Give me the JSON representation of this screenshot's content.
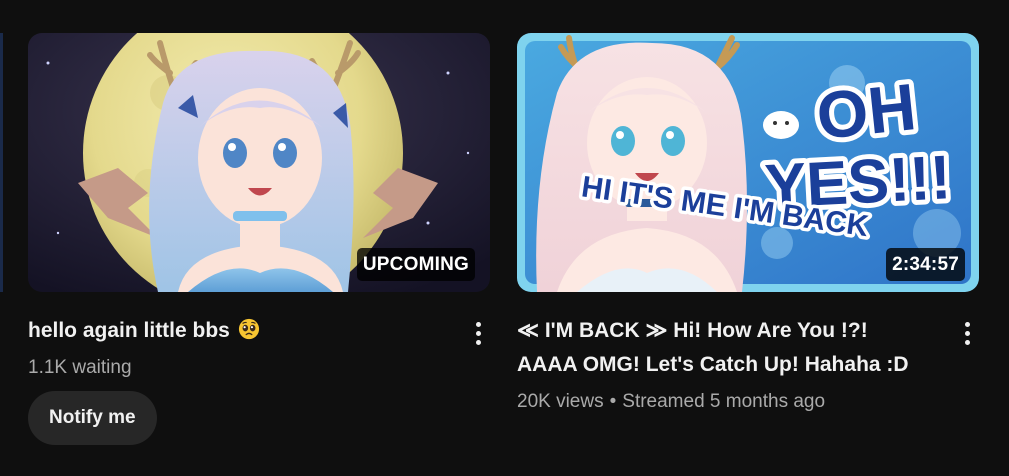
{
  "videos": [
    {
      "title": "hello again little bbs",
      "emoji": "pleading-face",
      "badge": "UPCOMING",
      "stats": "1.1K waiting",
      "action_label": "Notify me"
    },
    {
      "title_line1": "≪ I'M BACK ≫ Hi! How Are You !?!",
      "title_line2": "AAAA OMG! Let's Catch Up! Hahaha :D",
      "badge": "2:34:57",
      "views": "20K views",
      "separator": "•",
      "streamed": "Streamed 5 months ago",
      "thumb_text": {
        "line1": "OH",
        "line2": "YES!!!",
        "line3": "HI IT'S ME I'M BACK"
      }
    }
  ],
  "colors": {
    "background": "#0f0f0f",
    "title": "#f1f1f1",
    "secondary": "#aaaaaa",
    "button_bg": "#272727",
    "thumb2_frame": "#7fd3ee",
    "thumb2_text": "#1b3f9a"
  }
}
